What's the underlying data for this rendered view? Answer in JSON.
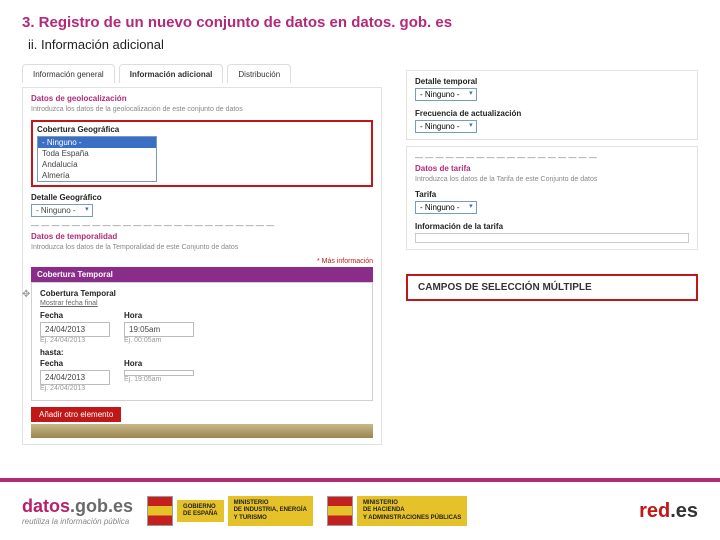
{
  "title": "3. Registro de un nuevo conjunto de datos en datos. gob. es",
  "subtitle": "ii. Información adicional",
  "tabs": {
    "general": "Información general",
    "adicional": "Información adicional",
    "dist": "Distribución"
  },
  "left": {
    "geoloc_section": "Datos de geolocalización",
    "geoloc_desc": "Introduzca los datos de la geolocalización de este conjunto de datos",
    "cov_geo_label": "Cobertura Geográfica",
    "cov_geo_options": [
      "- Ninguno -",
      "Toda España",
      "Andalucía",
      "Almería"
    ],
    "detail_geo_label": "Detalle Geográfico",
    "detail_geo_value": "- Ninguno -",
    "temp_section": "Datos de temporalidad",
    "temp_desc": "Introduzca los datos de la Temporalidad de este Conjunto de datos",
    "required_hint": "* Más información",
    "purple_header": "Cobertura Temporal",
    "cob_temp_label": "Cobertura Temporal",
    "add_another": "Añadir otro elemento",
    "date_label": "Fecha",
    "time_label": "Hora",
    "start_date": "24/04/2013",
    "start_time": "19:05am",
    "start_date_hint": "Ej. 24/04/2013",
    "start_time_hint": "Ej. 00:05am",
    "end_label": "hasta:",
    "end_date": "24/04/2013",
    "end_date_hint": "Ej. 24/04/2013",
    "end_time_hint": "Ej. 19:05am"
  },
  "right": {
    "det_temp_label": "Detalle temporal",
    "det_temp_value": "- Ninguno -",
    "freq_label": "Frecuencia de actualización",
    "freq_value": "- Ninguno -",
    "tarifa_section": "Datos de tarifa",
    "tarifa_desc": "Introduzca los datos de la Tarifa de este Conjunto de datos",
    "tarifa_label": "Tarifa",
    "tarifa_value": "- Ninguno -",
    "info_tarifa_label": "Información de la tarifa"
  },
  "callout": "CAMPOS DE SELECCIÓN MÚLTIPLE",
  "footer": {
    "datos1": "datos",
    "datos2": ".gob.es",
    "datos_tag": "reutiliza la información pública",
    "gov1": "GOBIERNO\nDE ESPAÑA",
    "gov2": "MINISTERIO\nDE INDUSTRIA, ENERGÍA\nY TURISMO",
    "gov3": "MINISTERIO\nDE HACIENDA\nY ADMINISTRACIONES PÚBLICAS",
    "red1": "red",
    "red2": ".es"
  }
}
